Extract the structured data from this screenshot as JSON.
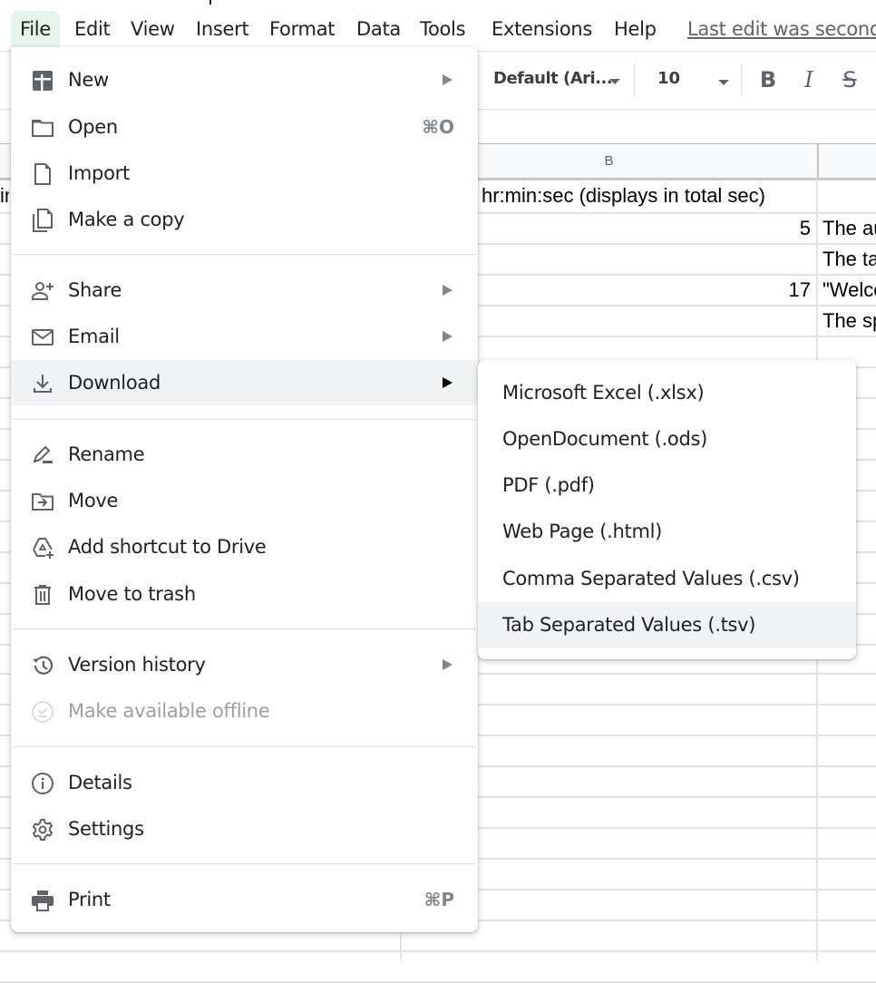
{
  "menubar": {
    "items": [
      "File",
      "Edit",
      "View",
      "Insert",
      "Format",
      "Data",
      "Tools",
      "Extensions",
      "Help"
    ],
    "active": "File",
    "last_edit": "Last edit was seconds ago"
  },
  "toolbar": {
    "font": "Default (Ari...",
    "font_size": "10",
    "bold_label": "B",
    "italic_label": "I",
    "strike_label": "S"
  },
  "sheet": {
    "column_headers": [
      "B"
    ],
    "rows": [
      {
        "a": "in",
        "b": "hr:min:sec (displays in total sec)",
        "c": ""
      },
      {
        "a": "",
        "b": "5",
        "c": "The au"
      },
      {
        "a": "",
        "b": "",
        "c": "The ta"
      },
      {
        "a": "",
        "b": "17",
        "c": "\"Welco"
      },
      {
        "a": "",
        "b": "",
        "c": "The sp"
      }
    ]
  },
  "file_menu": {
    "items": [
      {
        "label": "New",
        "icon": "new-spreadsheet-icon",
        "submenu": true
      },
      {
        "label": "Open",
        "icon": "folder-icon",
        "shortcut": "⌘O"
      },
      {
        "label": "Import",
        "icon": "file-icon"
      },
      {
        "label": "Make a copy",
        "icon": "copy-icon"
      },
      {
        "label": "Share",
        "icon": "person-add-icon",
        "submenu": true
      },
      {
        "label": "Email",
        "icon": "email-icon",
        "submenu": true
      },
      {
        "label": "Download",
        "icon": "download-icon",
        "submenu": true,
        "highlighted": true
      },
      {
        "label": "Rename",
        "icon": "rename-icon"
      },
      {
        "label": "Move",
        "icon": "move-folder-icon"
      },
      {
        "label": "Add shortcut to Drive",
        "icon": "drive-shortcut-icon"
      },
      {
        "label": "Move to trash",
        "icon": "trash-icon"
      },
      {
        "label": "Version history",
        "icon": "history-icon",
        "submenu": true
      },
      {
        "label": "Make available offline",
        "icon": "offline-icon",
        "disabled": true
      },
      {
        "label": "Details",
        "icon": "info-icon"
      },
      {
        "label": "Settings",
        "icon": "gear-icon"
      },
      {
        "label": "Print",
        "icon": "print-icon",
        "shortcut": "⌘P"
      }
    ]
  },
  "download_submenu": {
    "items": [
      {
        "label": "Microsoft Excel (.xlsx)"
      },
      {
        "label": "OpenDocument (.ods)"
      },
      {
        "label": "PDF (.pdf)"
      },
      {
        "label": "Web Page (.html)"
      },
      {
        "label": "Comma Separated Values (.csv)"
      },
      {
        "label": "Tab Separated Values (.tsv)",
        "highlighted": true
      }
    ]
  },
  "colors": {
    "active_menu_bg": "#e6f4ea",
    "hover_bg": "#f1f3f4",
    "icon": "#5f6368",
    "disabled_text": "#9aa0a6"
  }
}
